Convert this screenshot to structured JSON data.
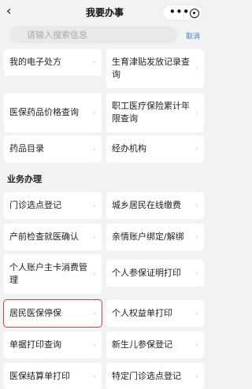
{
  "nav": {
    "title": "我要办事",
    "back_icon": "‹",
    "more_icon": "•••"
  },
  "search": {
    "placeholder": "请输入搜索信息",
    "cancel_label": "取消"
  },
  "colors": {
    "highlight": "#e23b3b",
    "link": "#3b82d6"
  },
  "top_items": [
    {
      "label": "我的电子处方"
    },
    {
      "label": "生育津贴发放记录查询"
    },
    {
      "label": "医保药品价格查询"
    },
    {
      "label": "职工医疗保险累计年限查询"
    },
    {
      "label": "药品目录"
    },
    {
      "label": "经办机构"
    }
  ],
  "section": {
    "title": "业务办理"
  },
  "business_items": [
    {
      "label": "门诊选点登记"
    },
    {
      "label": "城乡居民在线缴费"
    },
    {
      "label": "产前检查就医确认"
    },
    {
      "label": "亲情账户绑定/解绑"
    },
    {
      "label": "个人账户主卡消费管理"
    },
    {
      "label": "个人参保证明打印"
    },
    {
      "label": "居民医保停保",
      "highlighted": true
    },
    {
      "label": "个人权益单打印"
    },
    {
      "label": "单据打印查询"
    },
    {
      "label": "新生儿参保登记"
    },
    {
      "label": "医保结算单打印"
    },
    {
      "label": "特定门诊选点登记"
    }
  ]
}
